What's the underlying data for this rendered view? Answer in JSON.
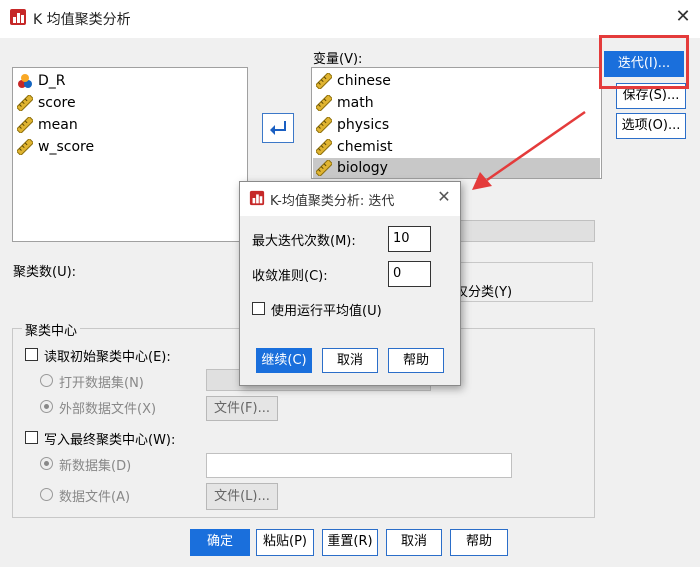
{
  "window": {
    "title": "K 均值聚类分析"
  },
  "source_list": [
    {
      "label": "D_R",
      "icon": "nominal-icon"
    },
    {
      "label": "score",
      "icon": "scale-ruler-icon"
    },
    {
      "label": "mean",
      "icon": "scale-ruler-icon"
    },
    {
      "label": "w_score",
      "icon": "scale-ruler-icon"
    }
  ],
  "variables": {
    "label": "变量(V):",
    "items": [
      "chinese",
      "math",
      "physics",
      "chemist",
      "biology"
    ],
    "selected_index": 4
  },
  "side_buttons": {
    "iterate": "迭代(I)...",
    "save": "保存(S)...",
    "options": "选项(O)..."
  },
  "clusters": {
    "label": "聚类数(U):"
  },
  "method_fragment": "仅分类(Y)",
  "cluster_centers": {
    "legend": "聚类中心",
    "read_initial": "读取初始聚类中心(E):",
    "open_dataset": "打开数据集(N)",
    "external_file": "外部数据文件(X)",
    "file_btn_1": "文件(F)...",
    "write_final": "写入最终聚类中心(W):",
    "new_dataset": "新数据集(D)",
    "data_file": "数据文件(A)",
    "file_btn_2": "文件(L)..."
  },
  "bottom_buttons": {
    "ok": "确定",
    "paste": "粘贴(P)",
    "reset": "重置(R)",
    "cancel": "取消",
    "help": "帮助"
  },
  "iterate_dialog": {
    "title": "K-均值聚类分析: 迭代",
    "max_iter_label": "最大迭代次数(M):",
    "max_iter_value": "10",
    "convergence_label": "收敛准则(C):",
    "convergence_value": "0",
    "running_mean_label": "使用运行平均值(U)",
    "continue": "继续(C)",
    "cancel": "取消",
    "help": "帮助"
  },
  "colors": {
    "accent": "#1a6fdc",
    "annotation": "#e43b3b"
  }
}
